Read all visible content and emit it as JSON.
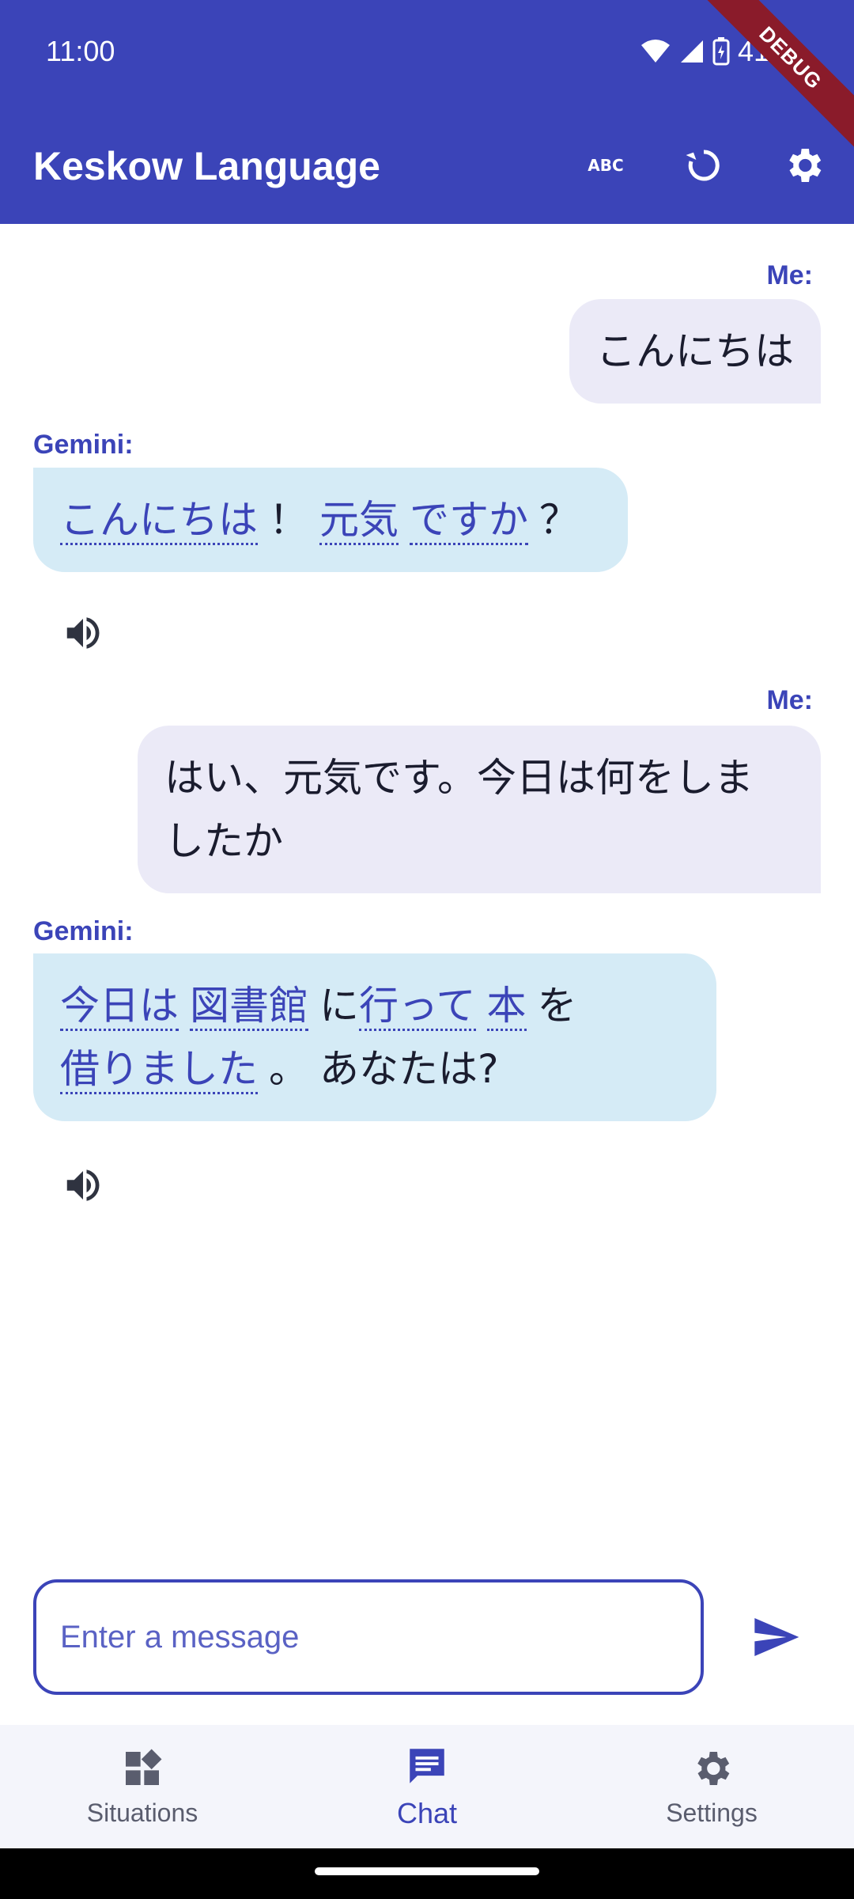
{
  "status": {
    "time": "11:00",
    "battery": "41%"
  },
  "debug_label": "DEBUG",
  "appbar": {
    "title": "Keskow Language"
  },
  "messages": [
    {
      "sender": "Me:",
      "text": "こんにちは"
    },
    {
      "sender": "Gemini:",
      "tokens": [
        {
          "text": "こんにちは",
          "link": true
        },
        {
          "text": "！",
          "link": false
        },
        {
          "text": "元気",
          "link": true
        },
        {
          "text": "ですか",
          "link": true
        },
        {
          "text": "？",
          "link": false
        }
      ]
    },
    {
      "sender": "Me:",
      "text_line1": "はい、元気です。今日は何をしま",
      "text_line2": "したか"
    },
    {
      "sender": "Gemini:",
      "tokens": [
        {
          "text": "今日は",
          "link": true
        },
        {
          "text": "図書館",
          "link": true
        },
        {
          "text": "に",
          "link": false
        },
        {
          "text": "行って",
          "link": true
        },
        {
          "text": "本",
          "link": true
        },
        {
          "text": "を",
          "link": false
        },
        {
          "text": "借りました",
          "link": true
        },
        {
          "text": "。",
          "link": false
        },
        {
          "text": "あなたは?",
          "link": false
        }
      ]
    }
  ],
  "input": {
    "placeholder": "Enter a message"
  },
  "nav": {
    "items": [
      "Situations",
      "Chat",
      "Settings"
    ],
    "active": "Chat"
  },
  "colors": {
    "primary": "#3b44b8",
    "me_bubble": "#ebeaf7",
    "gemini_bubble": "#d5ebf6"
  }
}
